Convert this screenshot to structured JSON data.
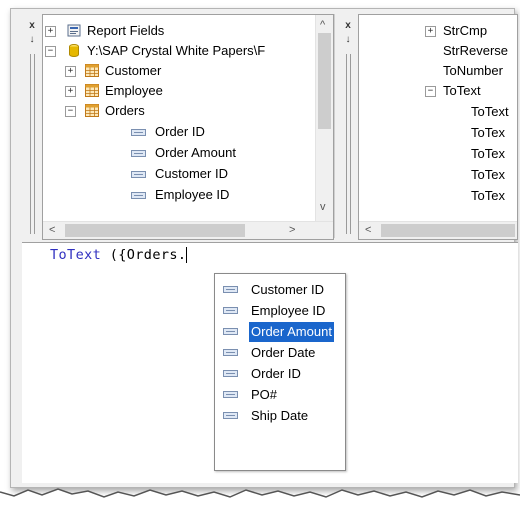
{
  "field_tree": {
    "items": [
      {
        "label": "Report Fields",
        "expander": "+",
        "icon": "report-fields-icon"
      },
      {
        "label": "Y:\\SAP Crystal White Papers\\F",
        "expander": "−",
        "icon": "database-icon"
      },
      {
        "label": "Customer",
        "expander": "+",
        "icon": "table-icon"
      },
      {
        "label": "Employee",
        "expander": "+",
        "icon": "table-icon"
      },
      {
        "label": "Orders",
        "expander": "−",
        "icon": "table-icon"
      },
      {
        "label": "Order ID",
        "icon": "field-icon"
      },
      {
        "label": "Order Amount",
        "icon": "field-icon"
      },
      {
        "label": "Customer ID",
        "icon": "field-icon"
      },
      {
        "label": "Employee ID",
        "icon": "field-icon"
      }
    ]
  },
  "function_tree": {
    "items": [
      {
        "label": "StrCmp",
        "expander": "+"
      },
      {
        "label": "StrReverse"
      },
      {
        "label": "ToNumber"
      },
      {
        "label": "ToText",
        "expander": "−"
      },
      {
        "label": "ToText"
      },
      {
        "label": "ToTex"
      },
      {
        "label": "ToTex"
      },
      {
        "label": "ToTex"
      },
      {
        "label": "ToTex"
      }
    ]
  },
  "editor": {
    "keyword": "ToText",
    "rest": " ({Orders."
  },
  "autocomplete": {
    "items": [
      "Customer ID",
      "Employee ID",
      "Order Amount",
      "Order Date",
      "Order ID",
      "PO#",
      "Ship Date"
    ],
    "selected": "Order Amount"
  },
  "side_buttons": {
    "close": "x",
    "pin": "↓"
  },
  "scroll_arrows": {
    "up": "^",
    "down": "v",
    "left": "<",
    "right": ">"
  },
  "colors": {
    "keyword": "#3030c0",
    "selection": "#1a66cc",
    "table_icon": "#e0a030",
    "database_icon": "#e6b800"
  }
}
